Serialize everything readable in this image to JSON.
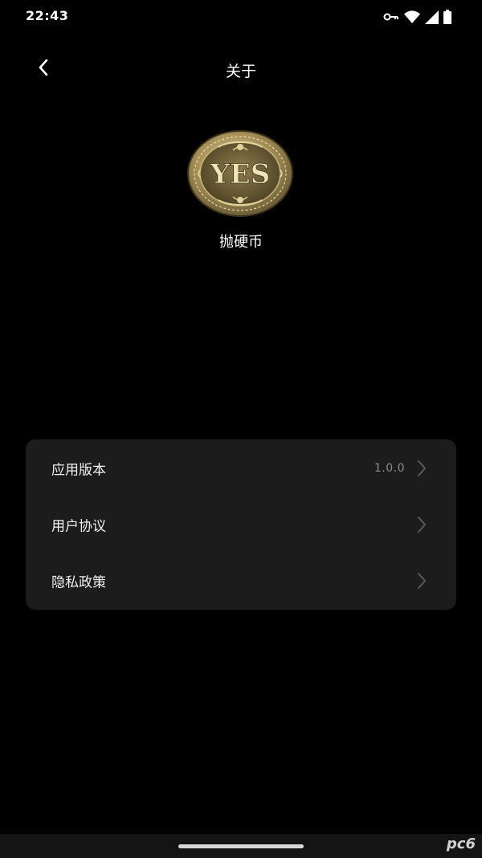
{
  "status_bar": {
    "time": "22:43",
    "icons": [
      "key-icon",
      "wifi-icon",
      "signal-icon",
      "battery-icon"
    ]
  },
  "header": {
    "title": "关于",
    "back_icon": "chevron-left-icon"
  },
  "app": {
    "logo_text": "YES",
    "name": "抛硬币"
  },
  "settings": {
    "items": [
      {
        "label": "应用版本",
        "value": "1.0.0"
      },
      {
        "label": "用户协议",
        "value": ""
      },
      {
        "label": "隐私政策",
        "value": ""
      }
    ]
  },
  "watermark": {
    "text": "pc6"
  },
  "colors": {
    "background": "#000000",
    "card": "#1c1c1c",
    "text": "#ffffff",
    "secondary_text": "#8e8e8e",
    "coin_gold": "#b8a46a"
  }
}
